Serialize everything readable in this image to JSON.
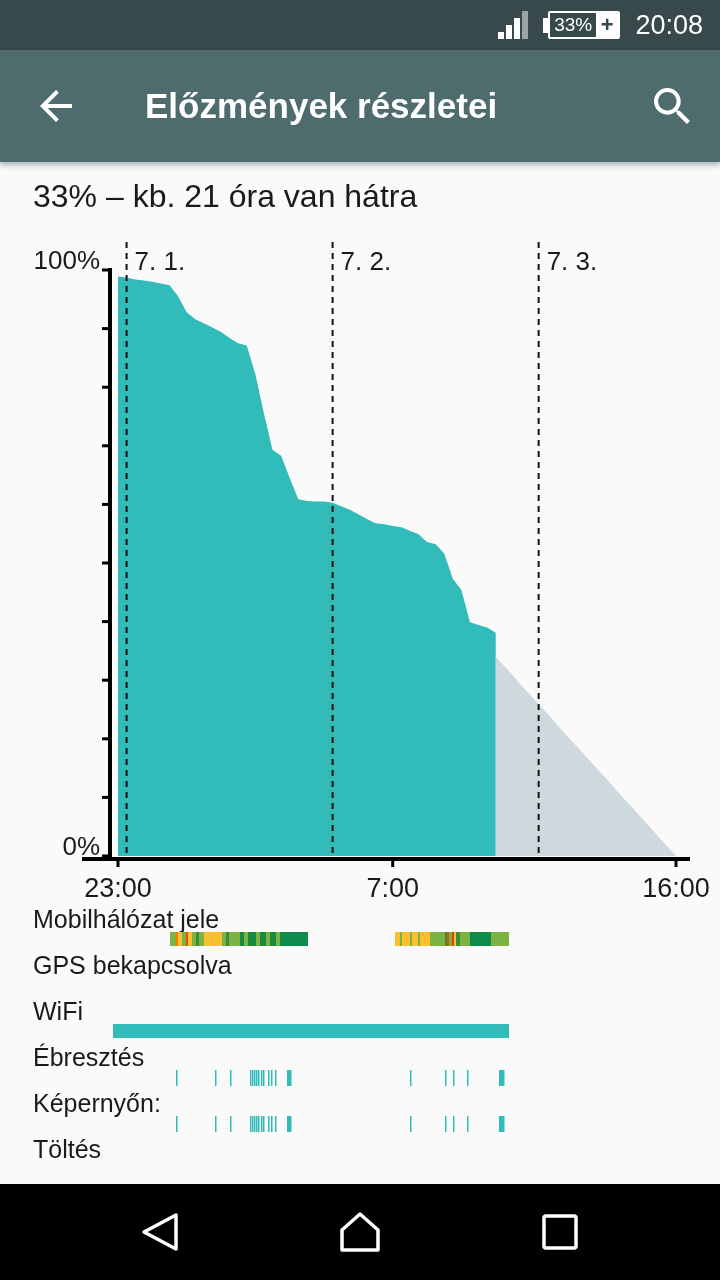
{
  "status_bar": {
    "battery": {
      "text": "33%",
      "level": 0.33,
      "sign": "+"
    },
    "time": "20:08"
  },
  "app_bar": {
    "title": "Előzmények részletei"
  },
  "summary": "33% – kb. 21 óra van hátra",
  "chart": {
    "chart_data": {
      "type": "area",
      "categories": [
        "23:00",
        null,
        null,
        null,
        null,
        null,
        null,
        null,
        null,
        null,
        null,
        null,
        null,
        null,
        null,
        null,
        null,
        null,
        null,
        null,
        null,
        null,
        null,
        null,
        null,
        null,
        null,
        null,
        null,
        null,
        null,
        null,
        "7:00",
        null,
        null,
        null,
        null,
        null,
        null,
        null,
        null,
        null,
        null,
        null,
        null,
        null,
        null,
        null,
        null,
        null,
        null,
        null,
        null,
        null,
        null,
        null,
        null,
        null,
        null,
        null,
        null,
        null,
        null,
        null,
        null,
        "16:00"
      ],
      "series": [
        {
          "color": "#31bbb9",
          "values": [
            98.9,
            98.7,
            98.4,
            98.2,
            98,
            97.7,
            97.4,
            95.5,
            92.8,
            91.6,
            90.9,
            90.2,
            89.4,
            88.4,
            87.5,
            87.1,
            82.2,
            75.5,
            69.3,
            68.3,
            64.5,
            60.9,
            60.6,
            60.5,
            60.5,
            60.3,
            59.7,
            59.1,
            58.3,
            57.5,
            56.8,
            56.6,
            56.3,
            56.1,
            55.5,
            54.9,
            53.6,
            53.2,
            51.6,
            47.3,
            45.4,
            39.9,
            39.4,
            39,
            38.1,
            null,
            null,
            null,
            null,
            null,
            null,
            null,
            null,
            null,
            null,
            null,
            null,
            null,
            null,
            null,
            null,
            null,
            null,
            null,
            null,
            null
          ]
        },
        {
          "color": "#cfd8dc",
          "values": [
            null,
            null,
            null,
            null,
            null,
            null,
            null,
            null,
            null,
            null,
            null,
            null,
            null,
            null,
            null,
            null,
            null,
            null,
            null,
            null,
            null,
            null,
            null,
            null,
            null,
            null,
            null,
            null,
            null,
            null,
            null,
            null,
            null,
            null,
            null,
            null,
            null,
            null,
            null,
            null,
            null,
            null,
            null,
            null,
            34,
            32.4,
            30.8,
            29.1,
            27.5,
            25.9,
            24.3,
            22.7,
            21,
            19.4,
            17.8,
            16.2,
            14.6,
            13,
            11.3,
            9.7,
            8.1,
            6.5,
            4.9,
            3.2,
            1.6,
            0
          ]
        }
      ],
      "ylim": [
        0,
        100
      ],
      "yticks": [
        {
          "value": 0,
          "label": "0%"
        },
        {
          "value": 100,
          "label": "100%"
        }
      ],
      "grid": "x",
      "annotations": [
        "7. 1.",
        "7. 2.",
        "7. 3."
      ]
    }
  },
  "timeline_rows": [
    {
      "label": "Mobilhálózat jele",
      "kind": "signal"
    },
    {
      "label": "GPS bekapcsolva",
      "kind": "empty"
    },
    {
      "label": "WiFi",
      "kind": "bar"
    },
    {
      "label": "Ébresztés",
      "kind": "ticks"
    },
    {
      "label": "Képernyőn:",
      "kind": "ticks"
    },
    {
      "label": "Töltés",
      "kind": "empty"
    }
  ]
}
